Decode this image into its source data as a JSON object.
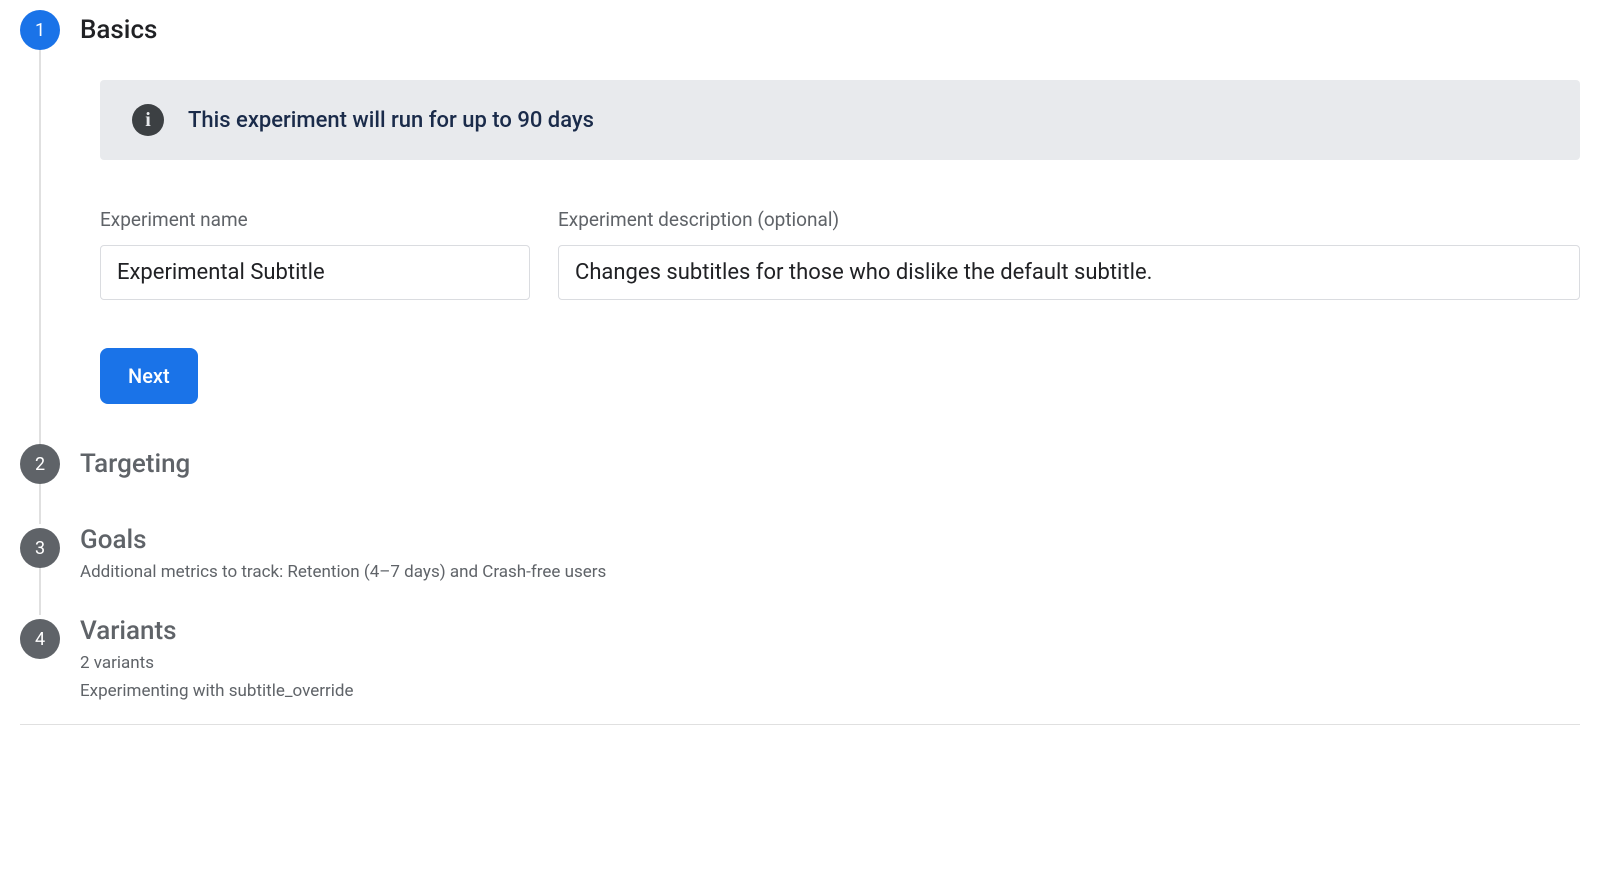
{
  "steps": {
    "basics": {
      "number": "1",
      "title": "Basics",
      "banner": "This experiment will run for up to 90 days",
      "name_label": "Experiment name",
      "name_value": "Experimental Subtitle",
      "desc_label": "Experiment description (optional)",
      "desc_value": "Changes subtitles for those who dislike the default subtitle.",
      "next_button": "Next"
    },
    "targeting": {
      "number": "2",
      "title": "Targeting"
    },
    "goals": {
      "number": "3",
      "title": "Goals",
      "subtitle": "Additional metrics to track: Retention (4–7 days) and Crash-free users"
    },
    "variants": {
      "number": "4",
      "title": "Variants",
      "subtitle1": "2 variants",
      "subtitle2": "Experimenting with subtitle_override"
    }
  }
}
